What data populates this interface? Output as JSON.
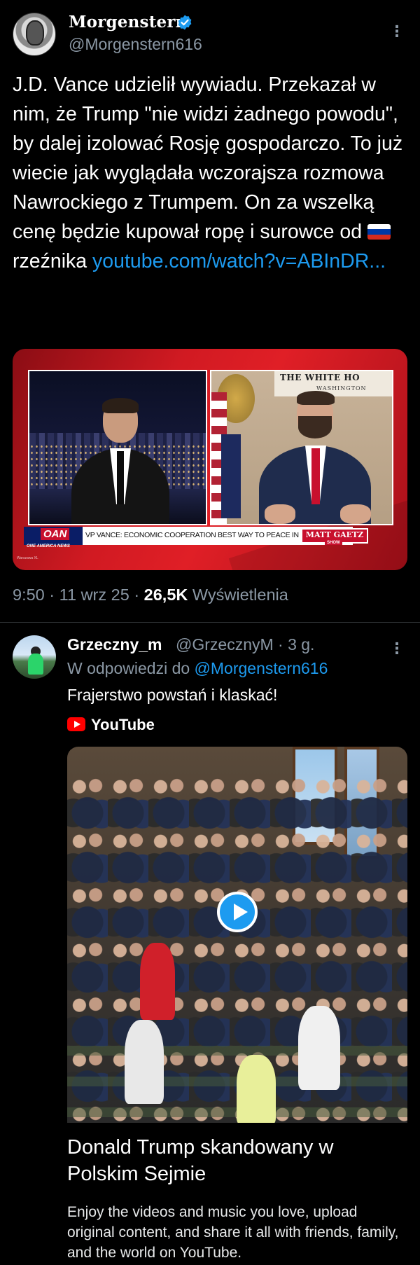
{
  "main_tweet": {
    "author": {
      "display_name": "Morgenstern",
      "handle": "@Morgenstern616"
    },
    "text_before_flag": "J.D. Vance udzielił wywiadu. Przekazał w nim, że Trump \"nie widzi żadnego powodu\", by dalej izolować Rosję gospodarczo. To już wiecie jak wyglądała wczorajsza rozmowa Nawrockiego z Trumpem. On za wszelką cenę będzie kupował ropę i surowce od ",
    "text_after_flag": "rzeźnika ",
    "link_text": "youtube.com/watch?v=ABInDR...",
    "flag_colors": [
      "#ffffff",
      "#0039a6",
      "#d52b1e"
    ],
    "media": {
      "network": "OAN",
      "network_sub": "ONE AMERICA NEWS",
      "chyron": "VP VANCE: ECONOMIC COOPERATION BEST WAY TO PEACE IN UKRAINE",
      "show_tag": "MATT GAETZ",
      "show_tag_sub": "SHOW",
      "backdrop_title": "THE WHITE HO",
      "backdrop_sub": "WASHINGTON",
      "corner_mark": "Warszawa XL"
    },
    "meta": {
      "time": "9:50",
      "date": "11 wrz 25",
      "views_count": "26,5K",
      "views_label": "Wyświetlenia",
      "separator": "·"
    }
  },
  "reply": {
    "author": {
      "display_name": "Grzeczny_m",
      "handle_time": "@GrzecznyM · 3 g."
    },
    "replying_prefix": "W odpowiedzi do ",
    "replying_handle": "@Morgenstern616",
    "text": "Frajerstwo powstań i klaskać!",
    "card": {
      "source": "YouTube",
      "title": "Donald Trump skandowany w Polskim Sejmie",
      "description": "Enjoy the videos and music you love, upload original content, and share it all with friends, family, and the world on YouTube."
    }
  },
  "colors": {
    "background": "#000000",
    "text_primary": "#ffffff",
    "text_secondary": "#8b98a5",
    "link": "#1d9bf0",
    "verified": "#1d9bf0",
    "youtube_red": "#ff0000"
  },
  "icons": [
    "verified-badge-icon",
    "more-options-icon",
    "youtube-logo-icon",
    "play-icon",
    "russia-flag-icon"
  ]
}
